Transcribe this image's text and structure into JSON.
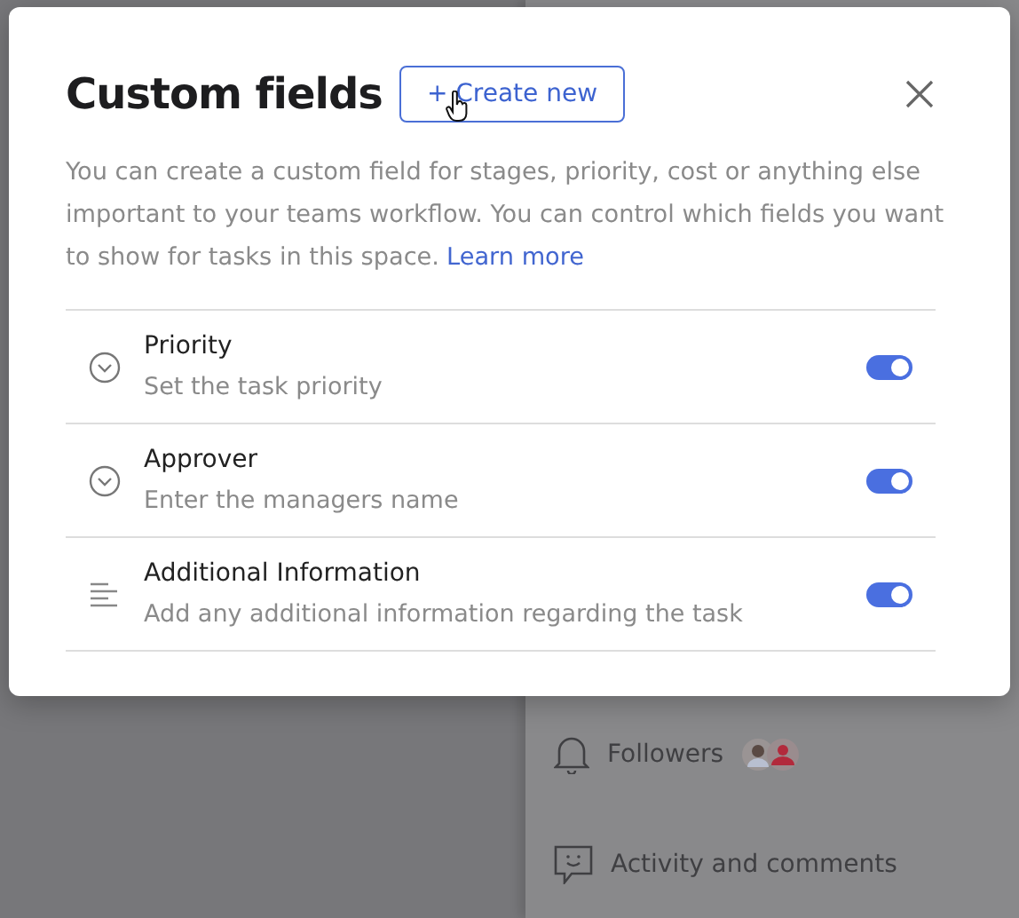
{
  "modal": {
    "title": "Custom fields",
    "create_button": "+ Create new",
    "description": "You can create a custom field for stages, priority, cost or anything else important to your teams workflow. You can control which fields you want to show for tasks in this space.",
    "learn_more": "Learn more",
    "fields": [
      {
        "kind": "dropdown",
        "name": "Priority",
        "hint": "Set the task priority",
        "on": true
      },
      {
        "kind": "dropdown",
        "name": "Approver",
        "hint": "Enter the managers name",
        "on": true
      },
      {
        "kind": "text",
        "name": "Additional Information",
        "hint": "Add any additional information regarding the task",
        "on": true
      }
    ]
  },
  "side_panel": {
    "items": [
      {
        "kind": "followers",
        "label": "Followers"
      },
      {
        "kind": "activity",
        "label": "Activity and comments"
      }
    ]
  }
}
